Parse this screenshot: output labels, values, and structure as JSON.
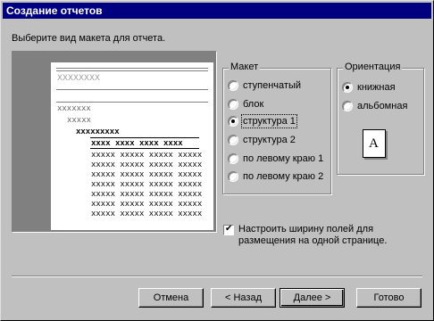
{
  "window": {
    "title": "Создание отчетов"
  },
  "prompt": "Выберите вид макета для отчета.",
  "preview": {
    "top_text": "XXXXXXXX",
    "level1": "xxxxxxx",
    "level2": "xxxxx",
    "level3": "xxxxxxxxx",
    "header_row": "xxxx  xxxx  xxxx  xxxx",
    "data_row": "xxxxx xxxxx xxxxx xxxxx"
  },
  "layout_group": {
    "title": "Макет",
    "options": [
      {
        "label": "ступенчатый",
        "selected": false
      },
      {
        "label": "блок",
        "selected": false
      },
      {
        "label": "структура 1",
        "selected": true
      },
      {
        "label": "структура 2",
        "selected": false
      },
      {
        "label": "по левому краю 1",
        "selected": false
      },
      {
        "label": "по левому краю 2",
        "selected": false
      }
    ]
  },
  "orientation_group": {
    "title": "Ориентация",
    "options": [
      {
        "label": "книжная",
        "selected": true
      },
      {
        "label": "альбомная",
        "selected": false
      }
    ],
    "icon_letter": "A"
  },
  "fit_checkbox": {
    "checked": true,
    "line1": "Настроить ширину полей для",
    "line2": "размещения на одной странице."
  },
  "buttons": {
    "cancel": "Отмена",
    "back": "< Назад",
    "next": "Далее >",
    "finish": "Готово"
  }
}
